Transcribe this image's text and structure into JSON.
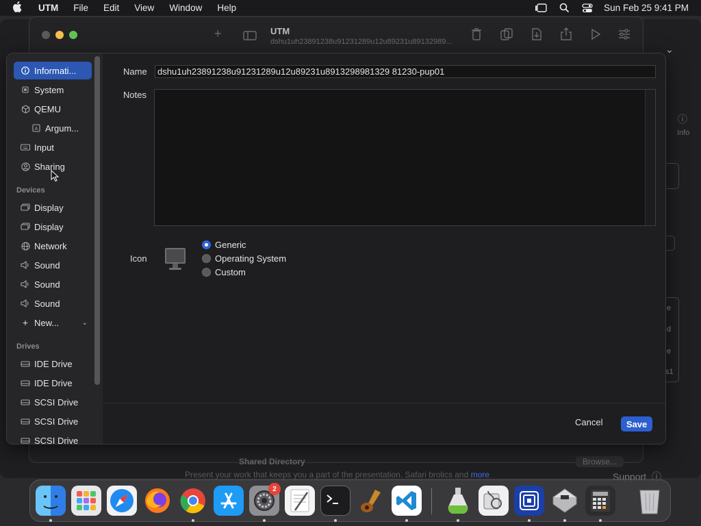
{
  "menubar": {
    "app": "UTM",
    "items": [
      "File",
      "Edit",
      "View",
      "Window",
      "Help"
    ],
    "clock": "Sun Feb 25  9:41 PM"
  },
  "main_window": {
    "title": "UTM",
    "subtitle": "dshu1uh23891238u91231289u12u89231u89132989...",
    "bottom_label": "Shared Directory",
    "bottom_button": "Browse...",
    "right_panel_label": "Info",
    "right_panel_fragments": [
      "e",
      "d",
      "e",
      "s1"
    ]
  },
  "background_text": {
    "line": "Present your work that keeps you a part of the presentation. Safari brolics and",
    "more": "more",
    "support": "Support"
  },
  "sidebar": {
    "items": [
      {
        "label": "Informati...",
        "icon": "info-icon"
      },
      {
        "label": "System",
        "icon": "cpu-icon"
      },
      {
        "label": "QEMU",
        "icon": "cube-icon"
      },
      {
        "label": "Argum...",
        "icon": "arguments-icon"
      },
      {
        "label": "Input",
        "icon": "keyboard-icon"
      },
      {
        "label": "Sharing",
        "icon": "person-circle-icon"
      }
    ],
    "devices_header": "Devices",
    "devices": [
      {
        "label": "Display",
        "icon": "display-icon"
      },
      {
        "label": "Display",
        "icon": "display-icon"
      },
      {
        "label": "Network",
        "icon": "globe-icon"
      },
      {
        "label": "Sound",
        "icon": "speaker-icon"
      },
      {
        "label": "Sound",
        "icon": "speaker-icon"
      },
      {
        "label": "Sound",
        "icon": "speaker-icon"
      },
      {
        "label": "New...",
        "icon": "plus-icon"
      }
    ],
    "drives_header": "Drives",
    "drives": [
      {
        "label": "IDE Drive",
        "icon": "drive-icon"
      },
      {
        "label": "IDE Drive",
        "icon": "drive-icon"
      },
      {
        "label": "SCSI Drive",
        "icon": "drive-icon"
      },
      {
        "label": "SCSI Drive",
        "icon": "drive-icon"
      },
      {
        "label": "SCSI Drive",
        "icon": "drive-icon"
      }
    ]
  },
  "form": {
    "name_label": "Name",
    "name_value": "dshu1uh23891238u91231289u12u89231u8913298981329 81230-pup01",
    "notes_label": "Notes",
    "notes_value": "",
    "icon_label": "Icon",
    "icon_options": [
      "Generic",
      "Operating System",
      "Custom"
    ],
    "icon_selected": "Generic",
    "cancel_label": "Cancel",
    "save_label": "Save"
  },
  "dock": {
    "apps": [
      "Finder",
      "Launchpad",
      "Safari",
      "Firefox",
      "Chrome",
      "App Store",
      "System Settings",
      "TextEdit",
      "Terminal",
      "Instruments",
      "Visual Studio Code",
      "Xcode Cleaner",
      "Disk Utility",
      "UTM",
      "Boot Camp Assistant",
      "Calculator",
      "Trash"
    ],
    "settings_badge": "2"
  },
  "colors": {
    "accent": "#2c5fcf",
    "selection": "#2c57b2",
    "sheet_bg": "#1e1e20",
    "sidebar_bg": "#262628"
  }
}
